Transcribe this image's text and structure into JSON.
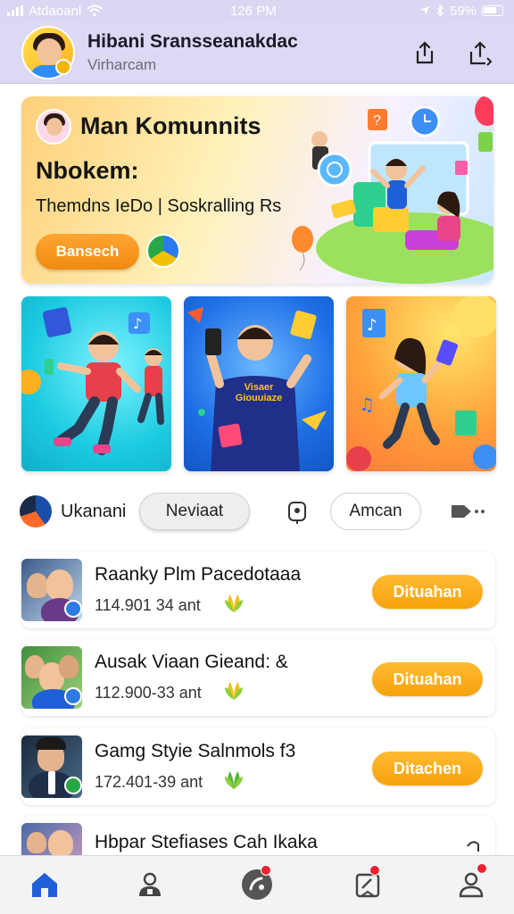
{
  "status_bar": {
    "carrier": "Atdaoanl",
    "time": "126 PM",
    "battery": "59%"
  },
  "header": {
    "title": "Hibani Sransseanakdac",
    "subtitle": "Virharcam"
  },
  "hero": {
    "title_line1": "Man Komunnits",
    "title_line2": "Nbokem:",
    "description": "Themdns IeDo | Soskralling Rs",
    "button_label": "Bansech"
  },
  "tiles": {
    "shirt_text_line1": "Visaer",
    "shirt_text_line2": "Giouuiaze"
  },
  "filters": {
    "label": "Ukanani",
    "chip_1": "Neviaat",
    "chip_2": "Amcan"
  },
  "list": [
    {
      "title": "Raanky Plm Pacedotaaa",
      "meta": "114.901 34 ant",
      "button": "Dituahan",
      "badge_color": "#2f7be6"
    },
    {
      "title": "Ausak Viaan Gieand: &",
      "meta": "112.900-33 ant",
      "button": "Dituahan",
      "badge_color": "#2f7be6"
    },
    {
      "title": "Gamg Styie Salnmols f3",
      "meta": "172.401-39 ant",
      "button": "Ditachen",
      "badge_color": "#27a845"
    },
    {
      "title": "Hbpar Stefiases Cah Ikaka"
    }
  ],
  "colors": {
    "accent_orange": "#f6a20a",
    "nav_active": "#1f5fd8",
    "nav_badge": "#e8222f"
  },
  "icons": {
    "header_actions": [
      "share-icon",
      "upload-icon"
    ],
    "nav": [
      "home-icon",
      "profile-icon",
      "chat-icon",
      "orders-icon",
      "account-icon"
    ]
  }
}
